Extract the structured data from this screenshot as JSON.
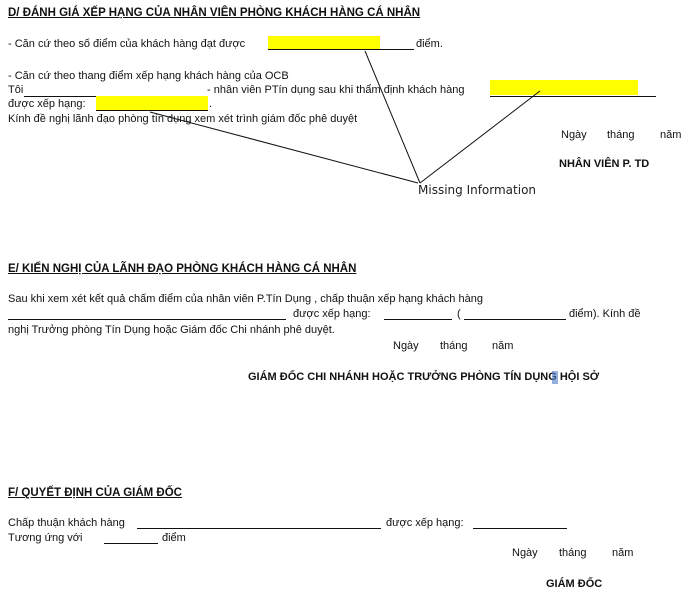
{
  "sectionD": {
    "heading": "D/ ĐÁNH GIÁ XẾP HẠNG CỦA NHÂN VIÊN PHÒNG KHÁCH HÀNG CÁ NHÂN",
    "line1_prefix": "- Căn  cứ theo số điểm của khách hàng đạt được",
    "line1_suffix": "điểm.",
    "line2": "- Căn cứ theo thang điểm xếp hạng khách hàng của OCB",
    "line3_prefix": "Tôi",
    "line3_mid": "- nhân viên PTín dụng  sau khi thẩm định khách hàng",
    "line4_prefix": "được xếp hạng:",
    "line4_suffix": ".",
    "line5": "Kính đề nghị lãnh đạo phòng tín dụng xem xét trình giám đốc phê duyệt",
    "date_day": "Ngày",
    "date_month": "tháng",
    "date_year": "năm",
    "signer": "NHÂN VIÊN P. TD"
  },
  "annotation": {
    "label": "Missing Information",
    "highlight_color": "#ffff00"
  },
  "sectionE": {
    "heading": "E/ KIẾN NGHỊ CỦA LÃNH ĐẠO PHÒNG KHÁCH HÀNG CÁ NHÂN",
    "line1": "Sau khi xem xét kết quả chấm điểm của nhân viên P.Tín Dụng ,  chấp thuận xếp hạng khách hàng",
    "line2_mid": "được xếp hạng:",
    "line2_paren_open": "(",
    "line2_suffix": "điểm). Kính đề",
    "line3": "nghị Trưởng phòng Tín Dụng hoặc Giám đốc Chi nhánh phê duyệt.",
    "date_day": "Ngày",
    "date_month": "tháng",
    "date_year": "năm",
    "signer": "GIÁM ĐỐC CHI NHÁNH HOẶC TRƯỞNG PHÒNG TÍN DỤNG HỘI SỞ"
  },
  "sectionF": {
    "heading": "F/ QUYẾT ĐỊNH CỦA GIÁM ĐỐC",
    "line1_prefix": "Chấp thuận khách hàng",
    "line1_mid": "được xếp hạng:",
    "line2_prefix": "Tương ứng với",
    "line2_suffix": "điểm",
    "date_day": "Ngày",
    "date_month": "tháng",
    "date_year": "năm",
    "signer": "GIÁM ĐỐC"
  }
}
